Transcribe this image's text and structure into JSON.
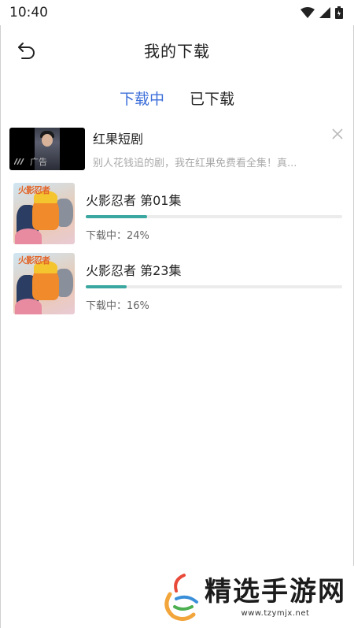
{
  "status_bar": {
    "time": "10:40",
    "icons": [
      "wifi-icon",
      "signal-icon",
      "battery-icon"
    ]
  },
  "header": {
    "title": "我的下载",
    "back_icon": "back-arrow-icon"
  },
  "tabs": [
    {
      "label": "下载中",
      "active": true
    },
    {
      "label": "已下载",
      "active": false
    }
  ],
  "ad": {
    "title": "红果短剧",
    "description": "别人花钱追的剧，我在红果免费看全集！真...",
    "tag": "广告",
    "close_icon": "close-icon"
  },
  "downloads": [
    {
      "title": "火影忍者  第01集",
      "status": "下载中：24%",
      "progress": 0.24,
      "cover_title": "火影忍者"
    },
    {
      "title": "火影忍者  第23集",
      "status": "下载中：16%",
      "progress": 0.16,
      "cover_title": "火影忍者"
    }
  ],
  "watermark": {
    "brand": "精选手游网",
    "url": "www.tzymjx.net"
  },
  "colors": {
    "accent": "#3d6fd9",
    "progress": "#3aa7a0",
    "track": "#ececec"
  }
}
